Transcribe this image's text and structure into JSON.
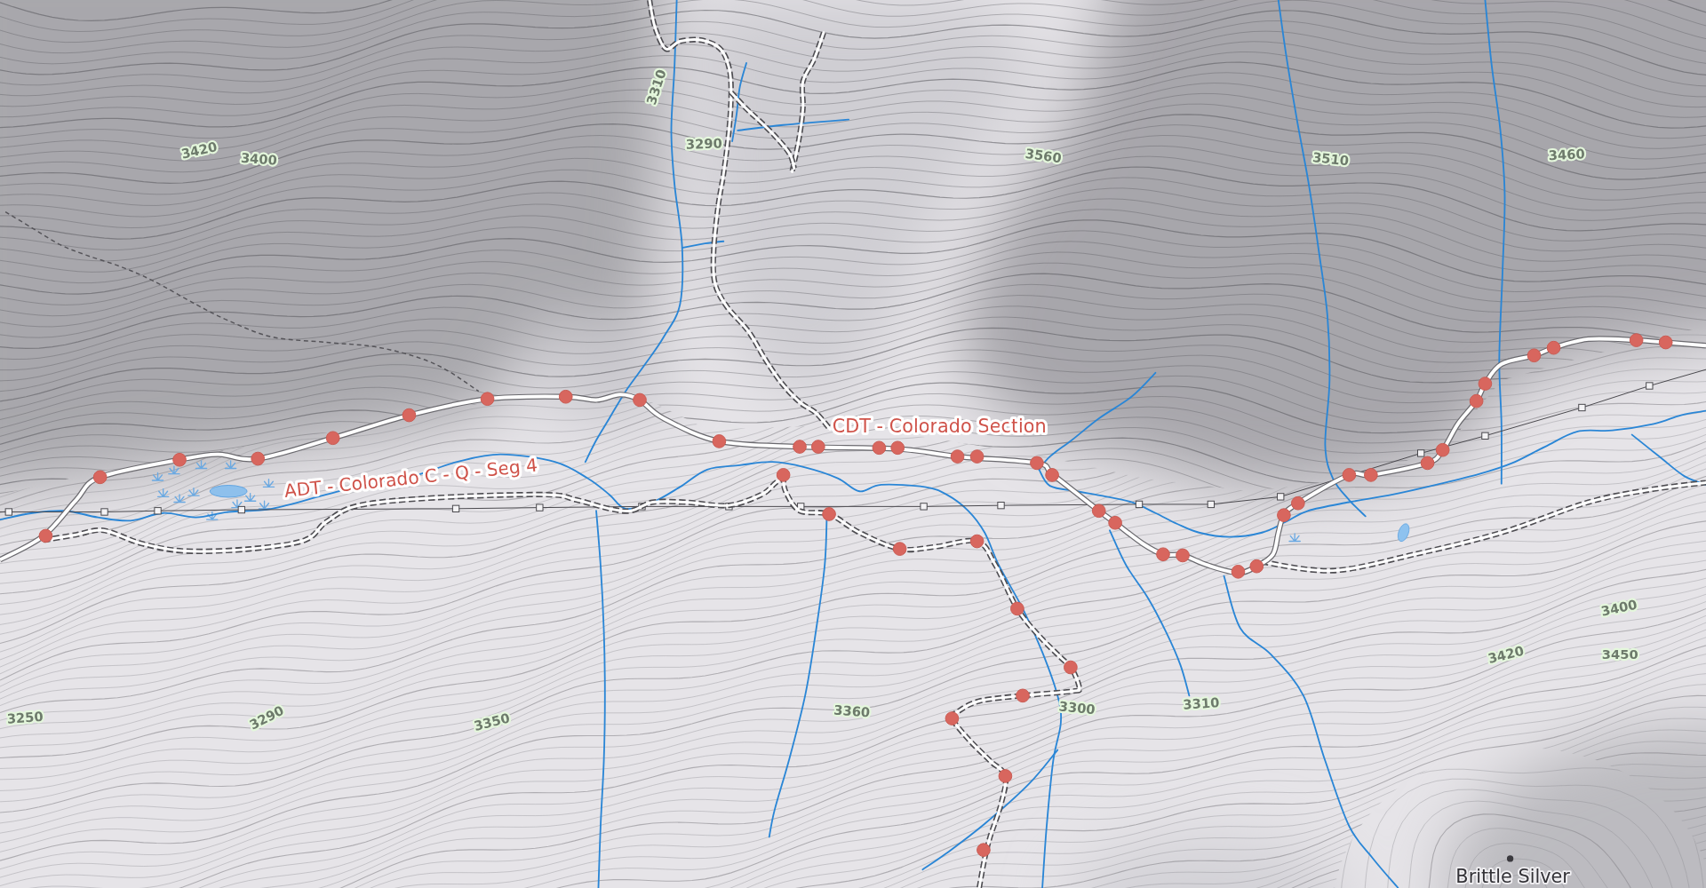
{
  "map": {
    "elevation_labels": [
      "3420",
      "3400",
      "3310",
      "3290",
      "3560",
      "3510",
      "3460",
      "3400",
      "3420",
      "3450",
      "3250",
      "3290",
      "3350",
      "3360",
      "3300",
      "3310"
    ],
    "route_labels": [
      "ADT - Colorado C - Q - Seg 4",
      "CDT - Colorado Section"
    ],
    "place_labels": [
      "Brittle Silver"
    ]
  }
}
